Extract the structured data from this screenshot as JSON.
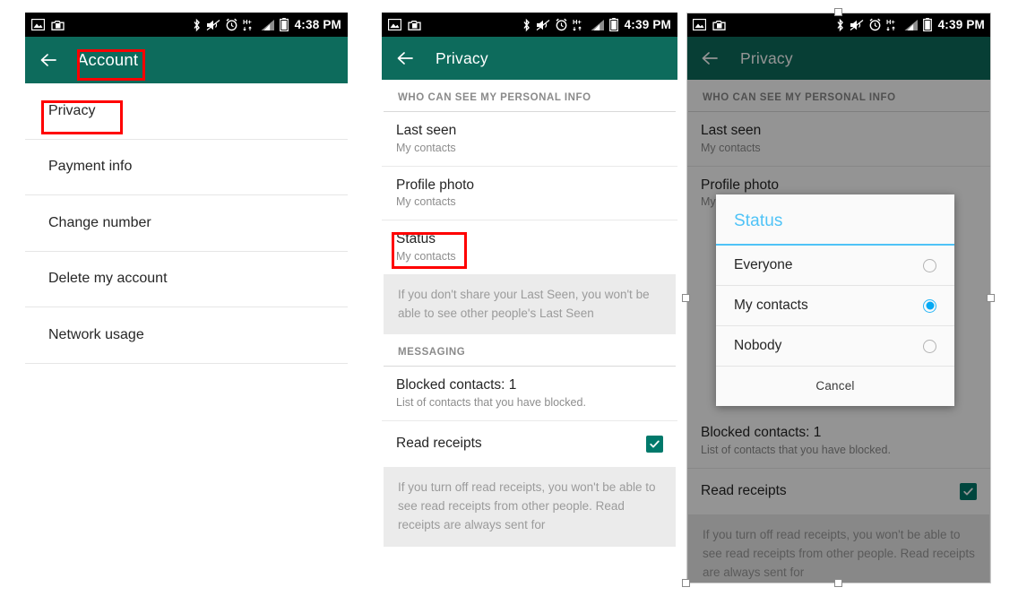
{
  "statusbar": {
    "icons": [
      "image-icon",
      "camera-upload-icon",
      "bluetooth-icon",
      "mute-icon",
      "alarm-icon",
      "hplus-data-icon",
      "signal-icon",
      "battery-icon"
    ],
    "time_panel1": "4:38 PM",
    "time_panel2": "4:39 PM",
    "time_panel3": "4:39 PM"
  },
  "colors": {
    "appbar_green": "#0d6b5c",
    "annotation_red": "#ff0000",
    "checkbox_teal": "#00796b",
    "dialog_blue": "#4fc3f7",
    "radio_blue": "#03a9f4"
  },
  "panel1": {
    "appbar": {
      "title": "Account",
      "back": "back-arrow-icon"
    },
    "items": [
      {
        "label": "Privacy"
      },
      {
        "label": "Payment info"
      },
      {
        "label": "Change number"
      },
      {
        "label": "Delete my account"
      },
      {
        "label": "Network usage"
      }
    ]
  },
  "panel2": {
    "appbar": {
      "title": "Privacy",
      "back": "back-arrow-icon"
    },
    "section1_header": "WHO CAN SEE MY PERSONAL INFO",
    "rows": [
      {
        "title": "Last seen",
        "sub": "My contacts"
      },
      {
        "title": "Profile photo",
        "sub": "My contacts"
      },
      {
        "title": "Status",
        "sub": "My contacts"
      }
    ],
    "info1": "If you don't share your Last Seen, you won't be able to see other people's Last Seen",
    "section2_header": "MESSAGING",
    "blocked": {
      "title": "Blocked contacts: 1",
      "sub": "List of contacts that you have blocked."
    },
    "read_receipts": {
      "title": "Read receipts",
      "checked": true
    },
    "info2": "If you turn off read receipts, you won't be able to see read receipts from other people. Read receipts are always sent for"
  },
  "panel3": {
    "appbar": {
      "title": "Privacy",
      "back": "back-arrow-icon"
    },
    "section1_header": "WHO CAN SEE MY PERSONAL INFO",
    "rows": [
      {
        "title": "Last seen",
        "sub": "My contacts"
      },
      {
        "title": "Profile photo",
        "sub": "My contacts"
      }
    ],
    "blocked": {
      "title": "Blocked contacts: 1",
      "sub": "List of contacts that you have blocked."
    },
    "read_receipts": {
      "title": "Read receipts",
      "checked": true
    },
    "info2": "If you turn off read receipts, you won't be able to see read receipts from other people. Read receipts are always sent for",
    "dialog": {
      "title": "Status",
      "options": [
        {
          "label": "Everyone",
          "selected": false
        },
        {
          "label": "My contacts",
          "selected": true
        },
        {
          "label": "Nobody",
          "selected": false
        }
      ],
      "cancel": "Cancel"
    }
  }
}
